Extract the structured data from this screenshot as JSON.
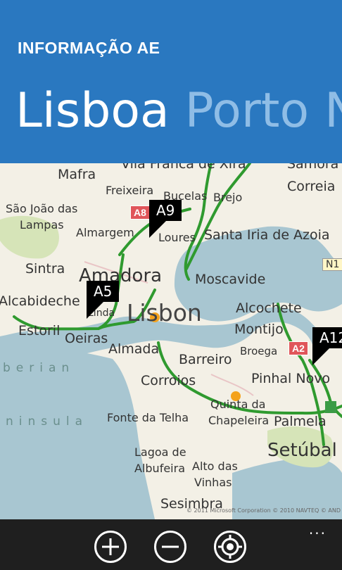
{
  "header": {
    "subtitle": "INFORMAÇÃO AE",
    "pivots": [
      "Lisboa",
      "Porto",
      "N"
    ]
  },
  "map": {
    "labels": {
      "mafra": "Mafra",
      "vila_franca": "Vila Franca de Xira",
      "samora": "Samora",
      "correia": "Correia",
      "freixeira": "Freixeira",
      "bucelas": "Bucelas",
      "brejo": "Brejo",
      "sao_joao": "São João das",
      "lampas": "Lampas",
      "almargem": "Almargem",
      "loures": "Loures",
      "santa_iria": "Santa Iria de Azoia",
      "sintra": "Sintra",
      "amadora": "Amadora",
      "moscavide": "Moscavide",
      "alcabideche": "Alcabideche",
      "linda": "Linda",
      "lisbon": "Lisbon",
      "alcochete": "Alcochete",
      "estoril": "Estoril",
      "oeiras": "Oeiras",
      "montijo": "Montijo",
      "almada": "Almada",
      "broega": "Broega",
      "barreiro": "Barreiro",
      "iberian": "berian",
      "corroios": "Corroios",
      "pinhal_novo": "Pinhal Novo",
      "quinta": "Quinta da",
      "chapeleira": "Chapeleira",
      "peninsula": "ninsula",
      "fonte_telha": "Fonte da Telha",
      "palmela": "Palmela",
      "setubal": "Setúbal",
      "lagoa": "Lagoa de",
      "albufeira": "Albufeira",
      "alto_vinhas": "Alto das",
      "vinhas": "Vinhas",
      "sesimbra": "Sesimbra"
    },
    "shields": {
      "a9": "A9",
      "a5": "A5",
      "a12": "A12"
    },
    "badges": {
      "a8": "A8",
      "a2": "A2",
      "n1": "N1"
    },
    "copyright": "© 2011 Microsoft Corporation   © 2010 NAVTEQ   © AND",
    "colors": {
      "water": "#a8c6d1",
      "land": "#f3f0e6",
      "road": "#2f9a2f",
      "incident": "#f4a21c"
    }
  },
  "appbar": {
    "zoom_in": "zoom in",
    "zoom_out": "zoom out",
    "locate": "locate",
    "more": "..."
  }
}
